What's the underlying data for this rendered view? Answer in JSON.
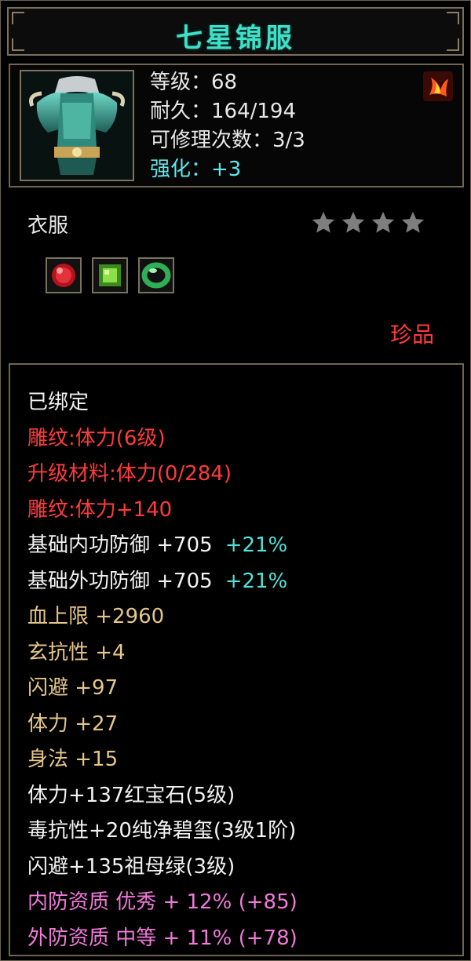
{
  "item": {
    "name": "七星锦服",
    "level_line": "等级：68",
    "durability_line": "耐久：164/194",
    "repair_line": "可修理次数：3/3",
    "enhance_line": "强化：+3",
    "category": "衣服",
    "star_count": 4,
    "rarity": "珍品",
    "icon": "armor-chestplate-icon",
    "badge_icon": "fire-phoenix-icon"
  },
  "gems": [
    {
      "icon": "ruby-gem-icon",
      "color": "#d0202a"
    },
    {
      "icon": "peridot-gem-icon",
      "color": "#7bd23a"
    },
    {
      "icon": "jade-ring-icon",
      "color": "#3fb85a"
    }
  ],
  "attributes": [
    {
      "text": "已绑定",
      "color": "white"
    },
    {
      "text": "雕纹:体力(6级)",
      "color": "red"
    },
    {
      "text": "升级材料:体力(0/284)",
      "color": "red"
    },
    {
      "text": "雕纹:体力+140",
      "color": "red"
    },
    {
      "text": "基础内功防御 +705",
      "pct": "+21%",
      "color": "white"
    },
    {
      "text": "基础外功防御 +705",
      "pct": "+21%",
      "color": "white"
    },
    {
      "text": "血上限 +2960",
      "color": "gold"
    },
    {
      "text": "玄抗性 +4",
      "color": "gold"
    },
    {
      "text": "闪避 +97",
      "color": "gold"
    },
    {
      "text": "体力 +27",
      "color": "gold"
    },
    {
      "text": "身法 +15",
      "color": "gold"
    },
    {
      "text": "体力+137红宝石(5级)",
      "color": "white"
    },
    {
      "text": "毒抗性+20纯净碧玺(3级1阶)",
      "color": "white"
    },
    {
      "text": "闪避+135祖母绿(3级)",
      "color": "white"
    },
    {
      "text": "内防资质 优秀 + 12% (+85)",
      "color": "pink"
    },
    {
      "text": "外防资质 中等 + 11% (+78)",
      "color": "pink"
    }
  ],
  "colors": {
    "title": "#3ee0c8",
    "cyan": "#5fe5ea",
    "red": "#ff3b3b",
    "gold": "#e6c68a",
    "pink": "#f07ad8",
    "border": "#6f6552"
  }
}
